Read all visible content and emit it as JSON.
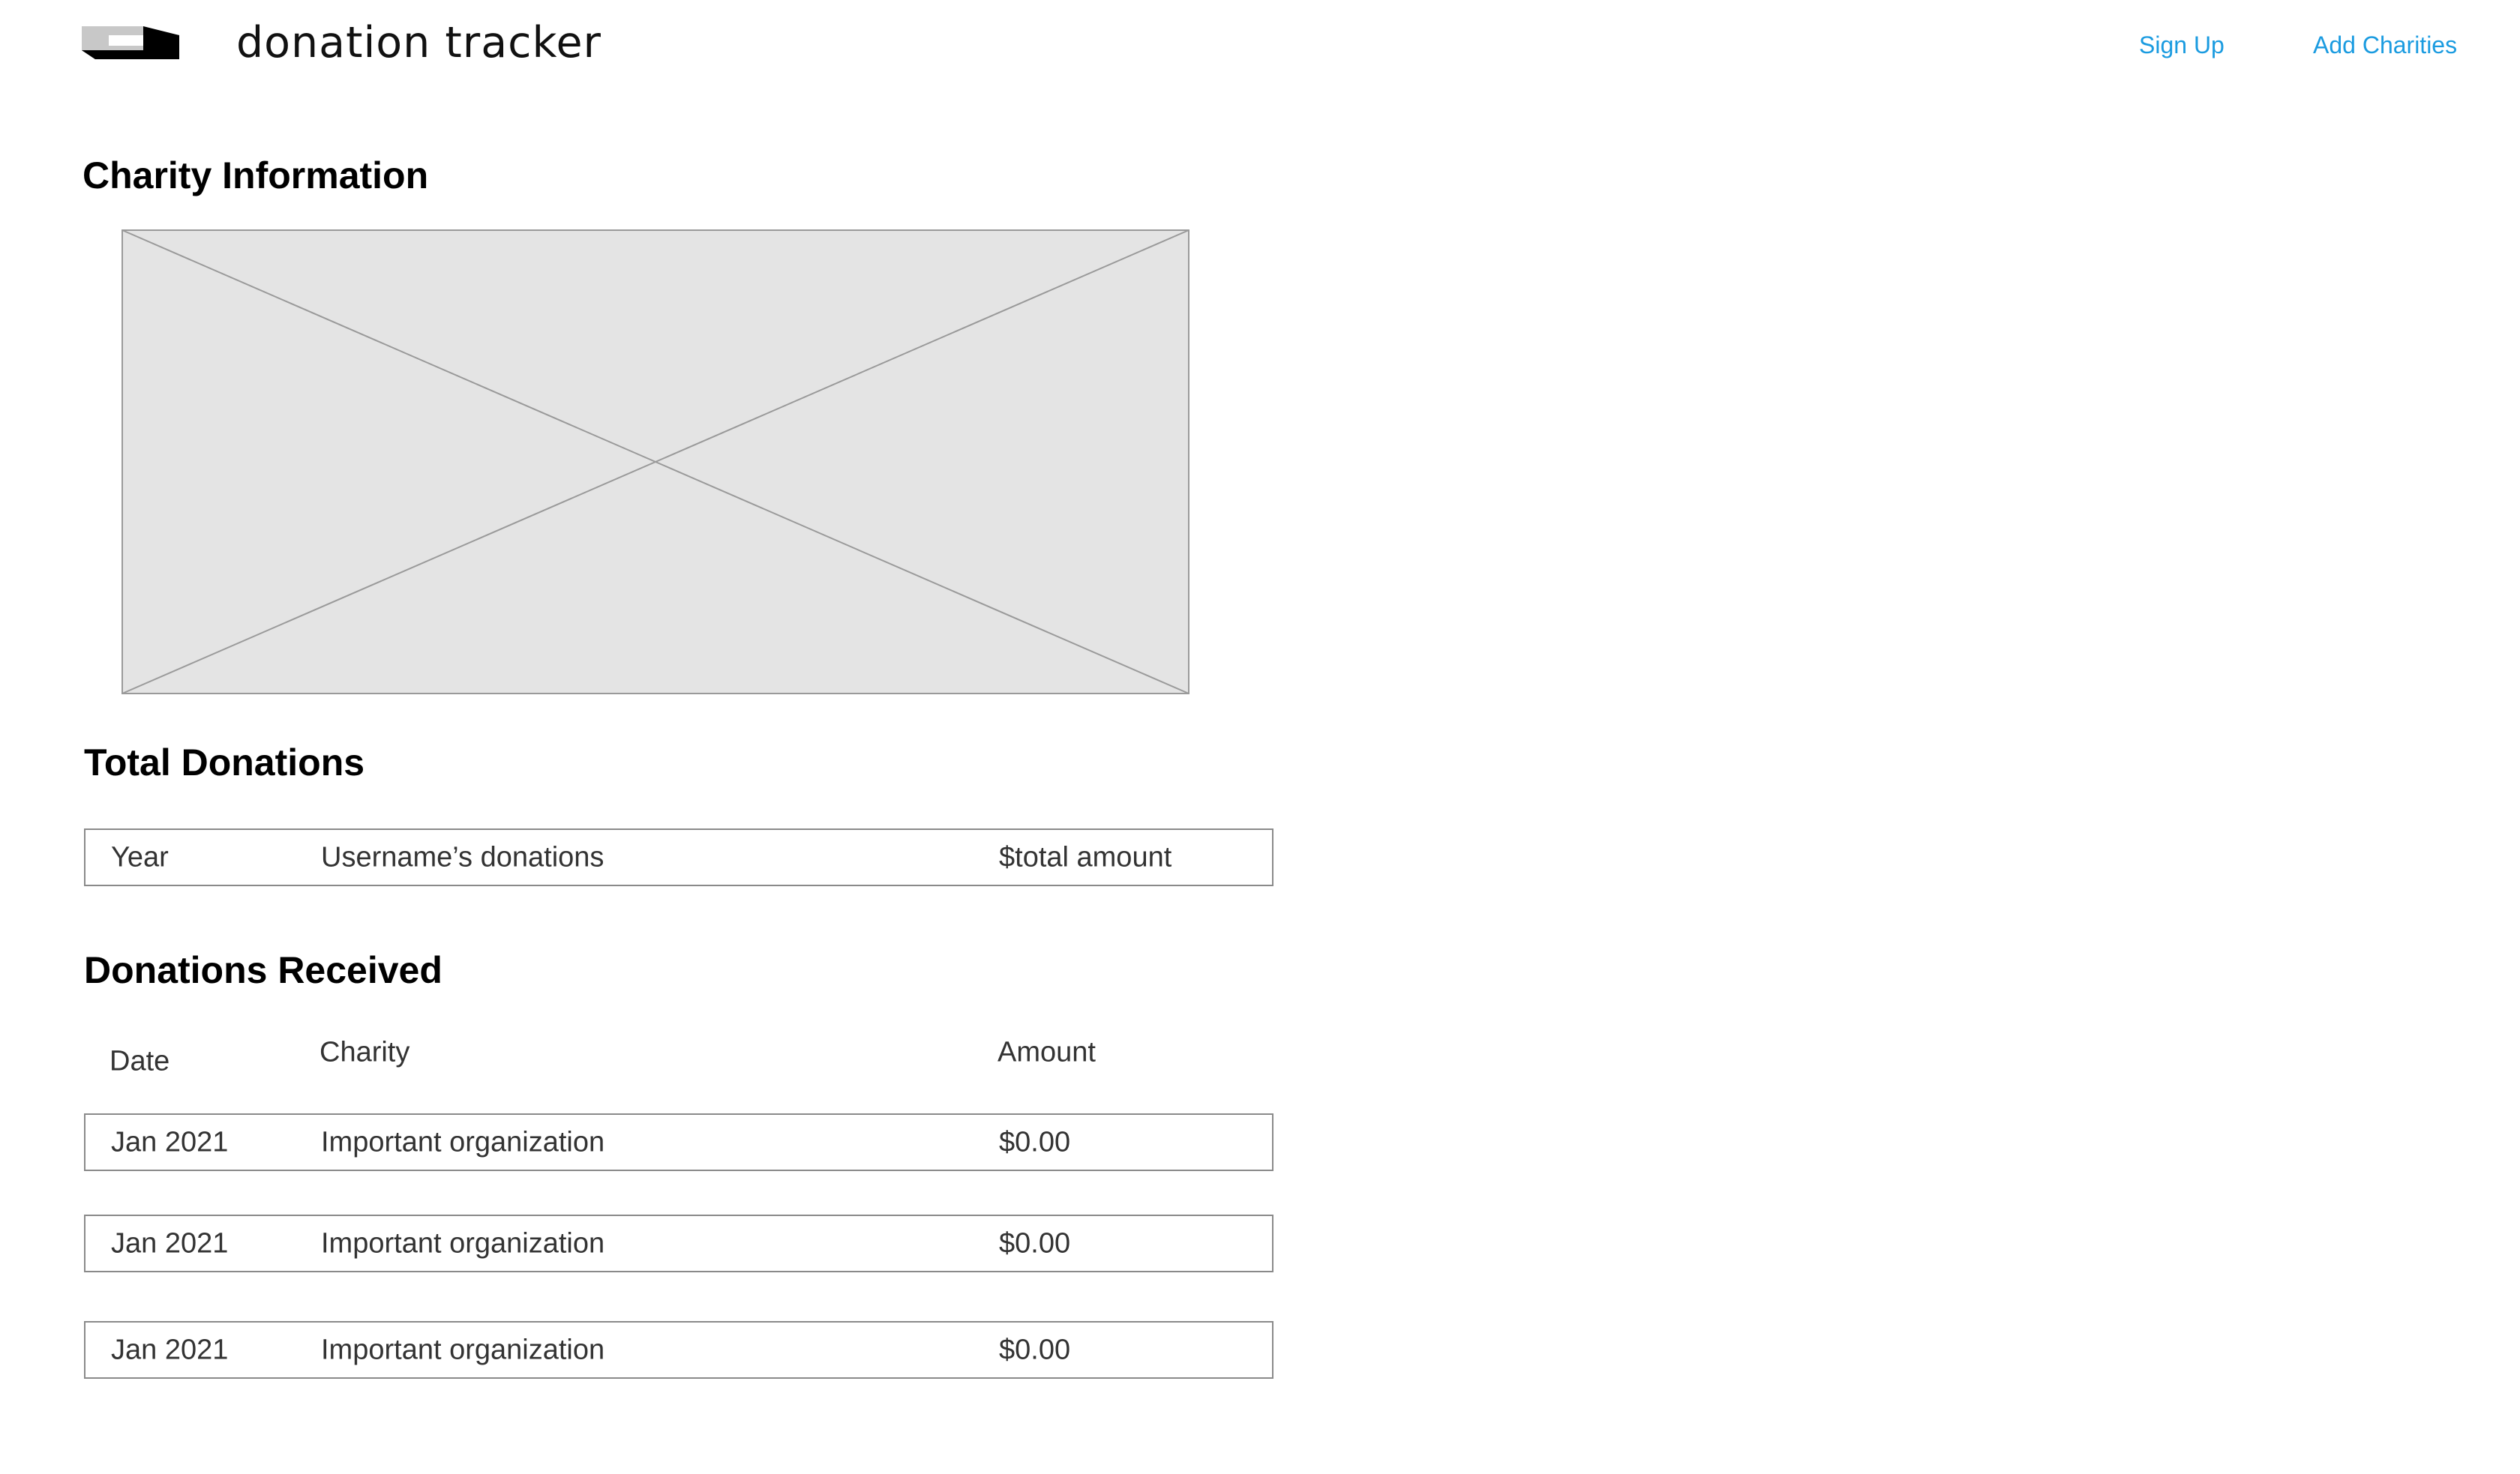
{
  "header": {
    "app_title": "donation tracker",
    "logo_icon": "logo-icon",
    "nav": {
      "sign_up": "Sign Up",
      "add_charities": "Add Charities"
    }
  },
  "charity_info": {
    "heading": "Charity Information",
    "image_icon": "image-placeholder-icon"
  },
  "total_donations": {
    "heading": "Total Donations",
    "row": {
      "year": "Year",
      "label": "Username’s donations",
      "amount": "$total amount"
    }
  },
  "donations_received": {
    "heading": "Donations Received",
    "columns": {
      "date": "Date",
      "charity": "Charity",
      "amount": "Amount"
    },
    "rows": [
      {
        "date": "Jan 2021",
        "charity": "Important organization",
        "amount": "$0.00"
      },
      {
        "date": "Jan 2021",
        "charity": "Important organization",
        "amount": "$0.00"
      },
      {
        "date": "Jan 2021",
        "charity": "Important organization",
        "amount": "$0.00"
      }
    ]
  },
  "colors": {
    "link": "#1a9be0",
    "placeholder_fill": "#e4e4e4",
    "border": "#8a8a8a"
  }
}
